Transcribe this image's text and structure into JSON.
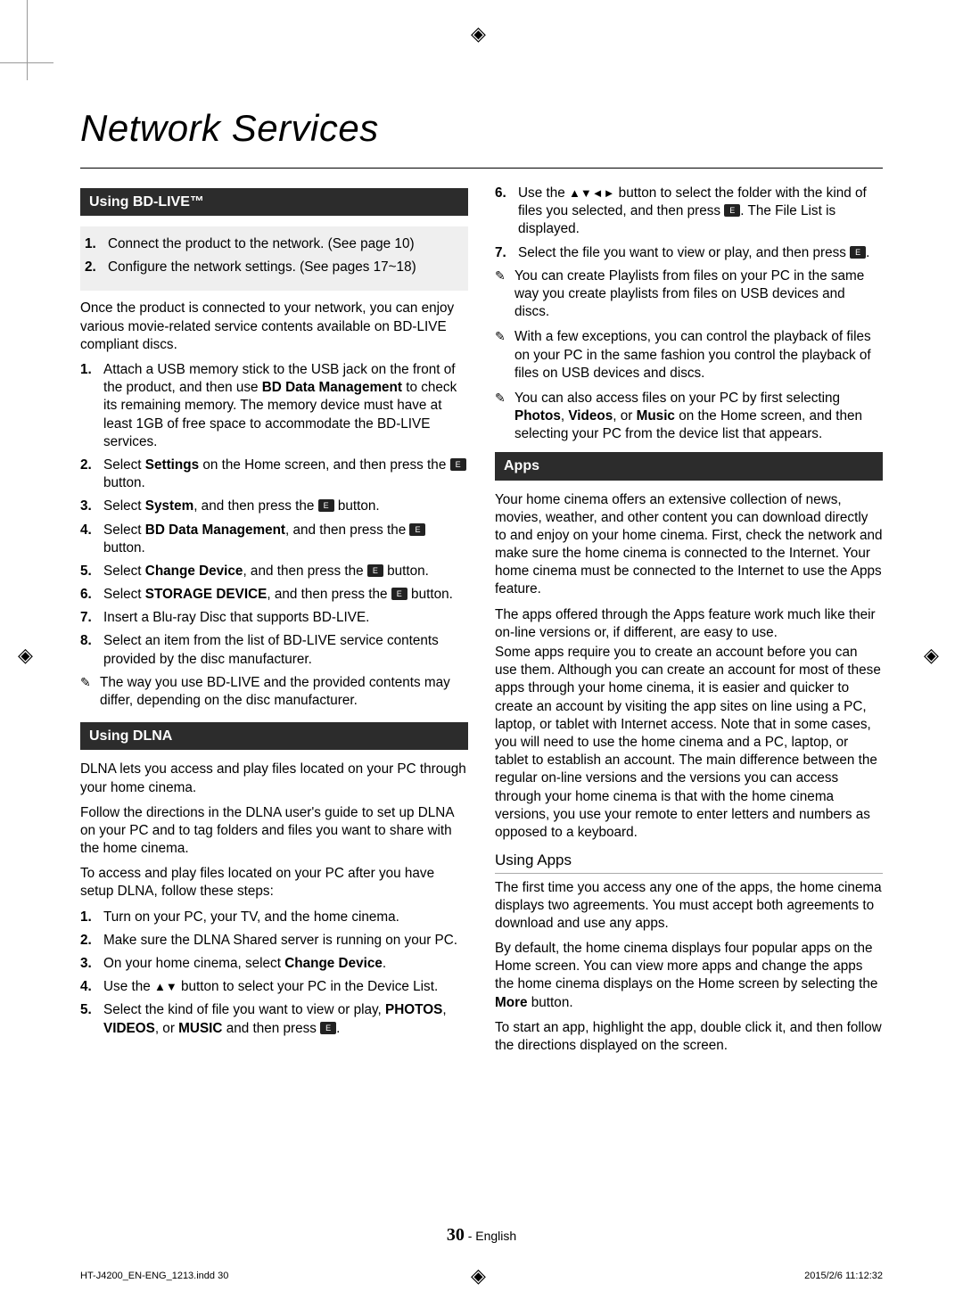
{
  "title": "Network Services",
  "left": {
    "sec1_header": "Using BD-LIVE™",
    "pre_box": [
      "Connect the product to the network. (See page 10)",
      "Configure the network settings. (See pages 17~18)"
    ],
    "intro": "Once the product is connected to your network, you can enjoy various movie-related service contents available on BD-LIVE compliant discs.",
    "steps1": [
      {
        "pre": "Attach a USB memory stick to the USB jack on the front of the product, and then use ",
        "bold": "BD Data Management",
        "post": " to check its remaining memory. The memory device must have at least 1GB of free space to accommodate the BD-LIVE services."
      },
      {
        "pre": "Select ",
        "bold": "Settings",
        "post": " on the Home screen, and then press the ",
        "enter": true,
        "tail": " button."
      },
      {
        "pre": "Select ",
        "bold": "System",
        "post": ", and then press the ",
        "enter": true,
        "tail": " button."
      },
      {
        "pre": "Select ",
        "bold": "BD Data Management",
        "post": ", and then press the ",
        "enter": true,
        "tail": " button."
      },
      {
        "pre": "Select ",
        "bold": "Change Device",
        "post": ", and then press the ",
        "enter": true,
        "tail": " button."
      },
      {
        "pre": "Select ",
        "bold": "STORAGE DEVICE",
        "post": ", and then press the ",
        "enter": true,
        "tail": " button."
      },
      {
        "pre": "Insert a Blu-ray Disc that supports BD-LIVE."
      },
      {
        "pre": "Select an item from the list of BD-LIVE service contents provided by the disc manufacturer."
      }
    ],
    "note1": "The way you use BD-LIVE and the provided contents may differ, depending on the disc manufacturer.",
    "sec2_header": "Using DLNA",
    "dlna_p1": "DLNA lets you access and play files located on your PC through your home cinema.",
    "dlna_p2": "Follow the directions in the DLNA user's guide to set up DLNA on your PC and to tag folders and files you want to share with the home cinema.",
    "dlna_p3": "To access and play files located on your PC after you have setup DLNA, follow these steps:",
    "dlna_steps": [
      {
        "pre": "Turn on your PC, your TV, and the home cinema."
      },
      {
        "pre": "Make sure the DLNA Shared server is running on your PC."
      },
      {
        "pre": "On your home cinema, select ",
        "bold": "Change Device",
        "post": "."
      },
      {
        "pre": "Use the ",
        "arrows": "▲▼",
        "post": " button to select your PC in the Device List."
      },
      {
        "pre": "Select the kind of file you want to view or play, ",
        "bold": "PHOTOS",
        "post": ", ",
        "bold2": "VIDEOS",
        "post2": ", or ",
        "bold3": "MUSIC",
        "post3": " and then press ",
        "enter": true,
        "tail": "."
      }
    ]
  },
  "right": {
    "cont_steps": [
      {
        "n": "6.",
        "pre": "Use the ",
        "arrows": "▲▼◄►",
        "post": " button to select the folder with the kind of files you selected, and then press ",
        "enter": true,
        "tail": ". The File List is displayed."
      },
      {
        "n": "7.",
        "pre": "Select the file you want to view or play, and then press ",
        "enter": true,
        "tail": "."
      }
    ],
    "notes": [
      "You can create Playlists from files on your PC in the same way you create playlists from files on USB devices and discs.",
      "With a few exceptions, you can control the playback of files on your PC in the same fashion you control the playback of files on USB devices and discs."
    ],
    "note_rich": {
      "pre": "You can also access files on your PC by first selecting ",
      "b1": "Photos",
      "m1": ", ",
      "b2": "Videos",
      "m2": ", or ",
      "b3": "Music",
      "post": "  on the Home screen, and then selecting your PC from the device list that appears."
    },
    "apps_header": "Apps",
    "apps_p1": "Your home cinema offers an extensive collection of news, movies, weather, and other content you can download directly to and enjoy on your home cinema. First, check the network and make sure the home cinema is connected to the Internet. Your home cinema must be connected to the Internet to use the Apps feature.",
    "apps_p2": "The apps offered through the Apps feature work much like their on-line versions or, if different, are easy to use.",
    "apps_p3": "Some apps require you to create an account before you can use them. Although you can create an account for most of these apps through your home cinema, it is easier and quicker to create an account by visiting the app sites on line using a PC, laptop, or tablet with Internet access. Note that in some cases, you will need to use the home cinema and a PC, laptop, or tablet to establish an account. The main difference between the regular on-line versions and the versions you can access through your home cinema is that with the home cinema versions, you use your remote to enter letters and numbers as opposed to a keyboard.",
    "using_apps_head": "Using Apps",
    "ua_p1": "The first time you access any one of the apps, the home cinema displays two agreements. You must accept both agreements to download and use any apps.",
    "ua_p2_pre": "By default, the home cinema displays four popular apps on the Home screen. You can view more apps and change the apps the home cinema displays on the Home screen by selecting the ",
    "ua_p2_bold": "More",
    "ua_p2_post": " button.",
    "ua_p3": "To start an app, highlight the app, double click it, and then follow the directions displayed on the screen."
  },
  "footer": {
    "page": "30",
    "lang": "English"
  },
  "meta": {
    "left": "HT-J4200_EN-ENG_1213.indd   30",
    "right": "2015/2/6   11:12:32"
  }
}
